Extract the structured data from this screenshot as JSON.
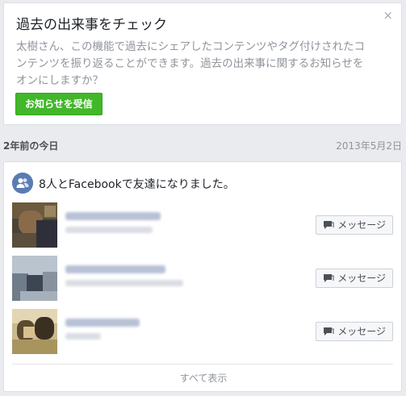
{
  "promo": {
    "title": "過去の出来事をチェック",
    "body": "太樹さん、この機能で過去にシェアしたコンテンツやタグ付けされたコンテンツを振り返ることができます。過去の出来事に関するお知らせをオンにしますか？",
    "enable_button": "お知らせを受信",
    "close_icon": "close-icon",
    "close_glyph": "×"
  },
  "section": {
    "label": "2年前の今日",
    "date": "2013年5月2日"
  },
  "memory": {
    "story_text": "8人とFacebookで友達になりました。",
    "story_icon": "friends-icon",
    "friends": [
      {
        "message_label": "メッセージ"
      },
      {
        "message_label": "メッセージ"
      },
      {
        "message_label": "メッセージ"
      }
    ],
    "see_all": "すべて表示"
  },
  "colors": {
    "accent_green": "#42b72a",
    "friends_badge": "#5b7bb4",
    "page_bg": "#e9ebee"
  }
}
